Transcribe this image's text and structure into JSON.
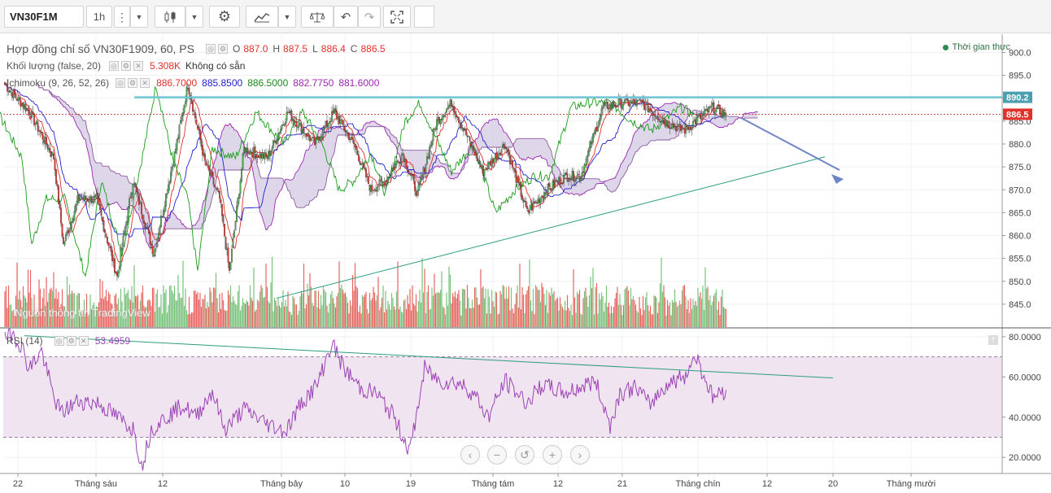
{
  "toolbar": {
    "symbol": "VN30F1M",
    "interval": "1h",
    "icons": [
      "candles-icon",
      "chevron-down-icon",
      "gear-icon",
      "indicators-icon",
      "chevron-down-icon",
      "compare-icon",
      "chevron-down-icon",
      "undo-icon",
      "redo-icon",
      "fullscreen-icon"
    ]
  },
  "legend": {
    "title": "Hợp đồng chỉ số VN30F1909, 60, PS",
    "o_label": "O",
    "o": "887.0",
    "h_label": "H",
    "h": "887.5",
    "l_label": "L",
    "l": "886.4",
    "c_label": "C",
    "c": "886.5",
    "volume_title": "Khối lượng (false, 20)",
    "volume_value": "5.308K",
    "volume_extra": "Không có sẵn",
    "ichimoku_title": "Ichimoku (9, 26, 52, 26)",
    "ichimoku_values": [
      "886.7000",
      "885.8500",
      "886.5000",
      "882.7750",
      "881.6000"
    ],
    "rsi_title": "RSI (14)",
    "rsi_value": "53.4959"
  },
  "realtime_label": "Thời gian thực",
  "watermark": "Nguồn thông tin TradingView",
  "colors": {
    "up": "#4caf50",
    "down": "#e0312c",
    "ichi_conv": "#2020d0",
    "ichi_base": "#e0312c",
    "ichi_lag": "#1a9c1a",
    "ichi_lead_a": "#9c27b0",
    "cloud": "#cfc6e0",
    "rsi": "#9b43b5",
    "rsi_band": "#f1e4f1",
    "resistance": "#6ec6d4",
    "trend": "#2a9d7f",
    "arrow": "#6f86c6"
  },
  "chart_data": [
    {
      "type": "candlestick",
      "title": "Hợp đồng chỉ số VN30F1909, 60, PS",
      "ylim": [
        840,
        904
      ],
      "y_ticks": [
        "900.0",
        "895.0",
        "890.0",
        "885.0",
        "880.0",
        "875.0",
        "870.0",
        "865.0",
        "860.0",
        "855.0",
        "850.0",
        "845.0"
      ],
      "x_ticks": [
        "22",
        "Tháng sáu",
        "12",
        "Tháng bảy",
        "10",
        "19",
        "Tháng tám",
        "12",
        "21",
        "Tháng chín",
        "12",
        "20",
        "Tháng mười"
      ],
      "key_points_close": [
        [
          0,
          893
        ],
        [
          20,
          887
        ],
        [
          40,
          877
        ],
        [
          48,
          858
        ],
        [
          60,
          868
        ],
        [
          75,
          868
        ],
        [
          92,
          851
        ],
        [
          105,
          872
        ],
        [
          122,
          856
        ],
        [
          140,
          879
        ],
        [
          150,
          893
        ],
        [
          164,
          876
        ],
        [
          176,
          868
        ],
        [
          184,
          852
        ],
        [
          196,
          879
        ],
        [
          215,
          877
        ],
        [
          232,
          887
        ],
        [
          254,
          880
        ],
        [
          270,
          887
        ],
        [
          286,
          880
        ],
        [
          300,
          870
        ],
        [
          312,
          872
        ],
        [
          326,
          878
        ],
        [
          338,
          869
        ],
        [
          354,
          885
        ],
        [
          366,
          889
        ],
        [
          392,
          874
        ],
        [
          410,
          880
        ],
        [
          428,
          865
        ],
        [
          444,
          870
        ],
        [
          460,
          873
        ],
        [
          472,
          873
        ],
        [
          490,
          888
        ],
        [
          505,
          889
        ],
        [
          522,
          889
        ],
        [
          540,
          885
        ],
        [
          556,
          883
        ],
        [
          566,
          885
        ],
        [
          580,
          888
        ],
        [
          590,
          886.5
        ]
      ],
      "last_close": 886.5,
      "resistance_level": 890.2,
      "last_price_label": "886.5",
      "resistance_label": "890.2",
      "grid": true
    },
    {
      "type": "bar",
      "title": "Khối lượng (false, 20)",
      "last_value": "5.308K"
    },
    {
      "type": "line",
      "title": "RSI (14)",
      "ylim": [
        12,
        84
      ],
      "y_ticks": [
        "80.0000",
        "60.0000",
        "40.0000",
        "20.0000"
      ],
      "band": [
        30,
        70
      ],
      "last_value": 53.4959,
      "key_points": [
        [
          0,
          78
        ],
        [
          6,
          82
        ],
        [
          14,
          75
        ],
        [
          20,
          64
        ],
        [
          30,
          73
        ],
        [
          40,
          50
        ],
        [
          46,
          42
        ],
        [
          60,
          48
        ],
        [
          76,
          47
        ],
        [
          90,
          41
        ],
        [
          106,
          34
        ],
        [
          112,
          15
        ],
        [
          120,
          34
        ],
        [
          132,
          40
        ],
        [
          146,
          46
        ],
        [
          156,
          40
        ],
        [
          170,
          53
        ],
        [
          180,
          34
        ],
        [
          196,
          44
        ],
        [
          214,
          37
        ],
        [
          230,
          33
        ],
        [
          244,
          48
        ],
        [
          256,
          56
        ],
        [
          268,
          77
        ],
        [
          278,
          64
        ],
        [
          292,
          54
        ],
        [
          304,
          52
        ],
        [
          318,
          41
        ],
        [
          332,
          23
        ],
        [
          344,
          64
        ],
        [
          356,
          58
        ],
        [
          372,
          57
        ],
        [
          384,
          52
        ],
        [
          396,
          40
        ],
        [
          410,
          58
        ],
        [
          428,
          47
        ],
        [
          440,
          56
        ],
        [
          460,
          52
        ],
        [
          484,
          58
        ],
        [
          496,
          36
        ],
        [
          504,
          52
        ],
        [
          518,
          55
        ],
        [
          528,
          46
        ],
        [
          542,
          56
        ],
        [
          558,
          61
        ],
        [
          566,
          71
        ],
        [
          580,
          50
        ],
        [
          590,
          53.5
        ]
      ]
    }
  ],
  "nav_buttons": [
    "‹",
    "−",
    "↺",
    "+",
    "›"
  ]
}
